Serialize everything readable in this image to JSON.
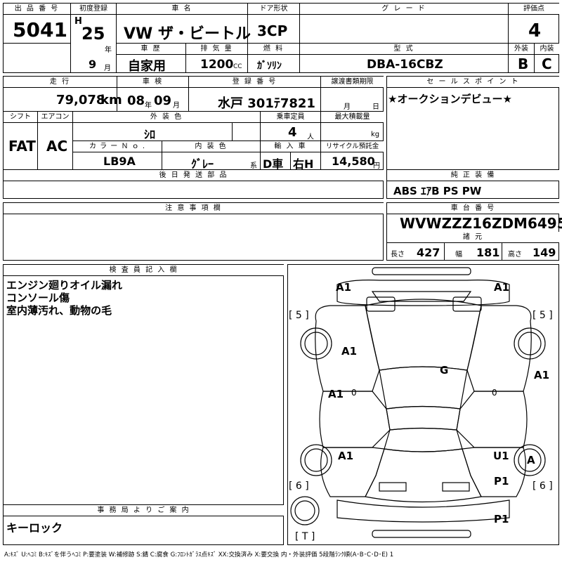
{
  "header": {
    "lot_label": "出 品 番 号",
    "lot_number": "5041",
    "first_reg_label": "初度登録",
    "era": "H",
    "year": "25",
    "year_unit": "年",
    "month": "9",
    "month_unit": "月",
    "car_name_label": "車 名",
    "car_name": "VW ザ・ビートル",
    "door_label": "ドア形状",
    "door": "3CP",
    "grade_label": "グ レ ー ド",
    "grade": "",
    "score_label": "評価点",
    "score": "4",
    "history_label": "車 歴",
    "history": "自家用",
    "displacement_label": "排 気 量",
    "displacement": "1200",
    "displacement_unit": "CC",
    "fuel_label": "燃 料",
    "fuel": "ｶﾞｿﾘﾝ",
    "model_label": "型 式",
    "model": "DBA-16CBZ",
    "ext_label": "外装",
    "ext_grade": "B",
    "int_label": "内装",
    "int_grade": "C"
  },
  "row2": {
    "mileage_label": "走 行",
    "mileage": "79,078",
    "mileage_unit": "km",
    "inspection_label": "車 検",
    "insp_year": "08",
    "insp_year_unit": "年",
    "insp_month": "09",
    "insp_month_unit": "月",
    "plate_label": "登 録 番 号",
    "plate": "水戸 301ﾃ7821",
    "transfer_label": "譲渡書類期限",
    "transfer_month_unit": "月",
    "transfer_day_unit": "日",
    "shift_label": "シフト",
    "shift": "FAT",
    "ac_label": "エアコン",
    "ac": "AC",
    "color_label": "外 装 色",
    "color": "ｼﾛ",
    "capacity_label": "乗車定員",
    "capacity": "4",
    "capacity_unit": "人",
    "load_label": "最大積載量",
    "load_unit": "kg",
    "color_no_label": "カ ラ ー Ｎ ｏ .",
    "color_no": "LB9A",
    "int_color_label": "内 装 色",
    "int_color": "ｸﾞﾚｰ",
    "int_color_unit": "系",
    "import_label": "輸 入 車",
    "import_type": "D車",
    "steering": "右H",
    "recycle_label": "リサイクル預託金",
    "recycle": "14,580",
    "recycle_unit": "円",
    "sales_label": "セ ー ル ス ポ イ ン ト",
    "sales_text": "★オークションデビュー★",
    "later_label": "後 日 発 送 部 品",
    "equip_label": "純 正 装 備",
    "equip": "ABS ｴｱB PS PW"
  },
  "row3": {
    "notes_label": "注 意 事 項 欄",
    "vin_label": "車 台 番 号",
    "vin": "WVWZZZ16ZDM649569",
    "spec_label": "諸 元",
    "length_label": "長さ",
    "length": "427",
    "width_label": "幅",
    "width": "181",
    "height_label": "高さ",
    "height": "149"
  },
  "inspector": {
    "label": "検 査 員 記 入 欄",
    "lines": [
      "エンジン廻りオイル漏れ",
      "コンソール傷",
      "室内薄汚れ、動物の毛"
    ]
  },
  "office": {
    "label": "事 務 局 よ り ご 案 内",
    "text": "キーロック"
  },
  "diagram": {
    "marks": {
      "front_left": "A1",
      "front_right": "A1",
      "left_front_fender": "A1",
      "left_door": "A1",
      "left_rear": "A1",
      "right_front": "A1",
      "windshield": "G",
      "rear_right_u1": "U1",
      "rear_right_p1": "P1",
      "rear_p1": "P1",
      "wheel_right": "A",
      "tire_fl": "[ 5 ]",
      "tire_fr": "[ 5 ]",
      "tire_rl": "[ 6 ]",
      "tire_rr": "[ 6 ]",
      "trunk": "[ T ]",
      "zero_left": "0",
      "zero_right": "0"
    }
  },
  "legend": "A:ｷｽﾞ  U:ﾍｺﾐ  B:ｷｽﾞを伴うﾍｺﾐ  P:要塗装  W:補修跡  S:錆  C:腐食  G:ﾌﾛﾝﾄｶﾞﾗｽ点ｷｽﾞ  XX:交換済み  X:要交換   内・外装評価  5段階ﾗﾝｸ順(A･B･C･D･E) 1"
}
